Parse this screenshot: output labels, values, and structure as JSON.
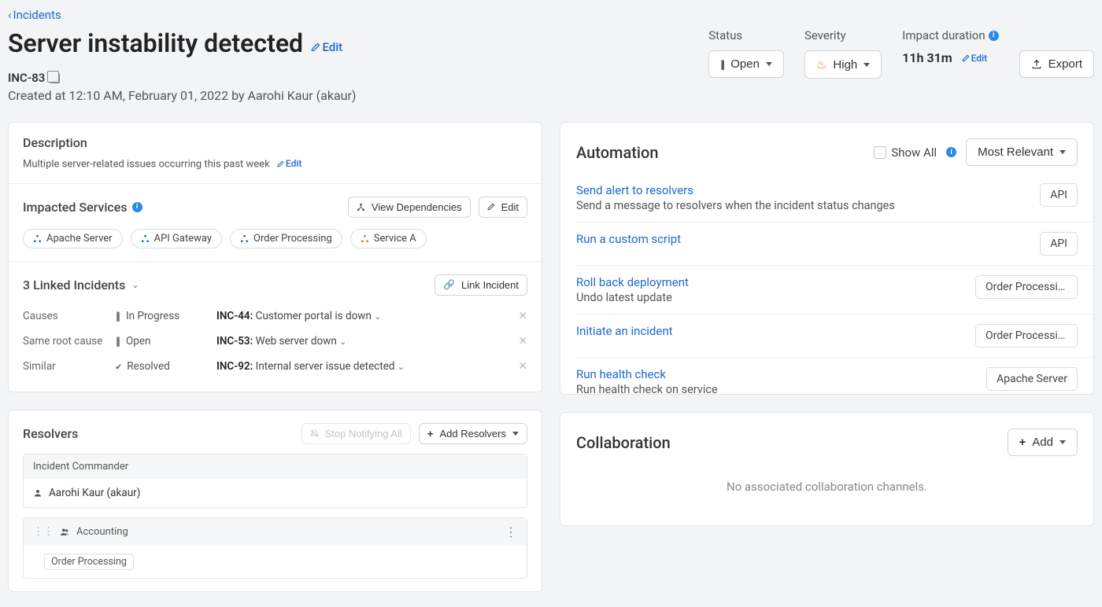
{
  "breadcrumb": {
    "back_label": "Incidents"
  },
  "header": {
    "title": "Server instability detected",
    "edit_label": "Edit",
    "incident_id": "INC-83",
    "created_at": "Created at 12:10 AM, February 01, 2022 by Aarohi Kaur (akaur)"
  },
  "meta": {
    "status_label": "Status",
    "status_value": "Open",
    "severity_label": "Severity",
    "severity_value": "High",
    "impact_label": "Impact duration",
    "impact_value": "11h 31m",
    "impact_edit": "Edit",
    "export_label": "Export"
  },
  "description": {
    "title": "Description",
    "text": "Multiple server-related issues occurring this past week",
    "edit_label": "Edit"
  },
  "impacted": {
    "title": "Impacted Services",
    "view_deps": "View Dependencies",
    "edit_label": "Edit",
    "services": [
      {
        "name": "Apache Server",
        "color": "blue"
      },
      {
        "name": "API Gateway",
        "color": "blue"
      },
      {
        "name": "Order Processing",
        "color": "blue"
      },
      {
        "name": "Service A",
        "color": "orange"
      }
    ]
  },
  "linked": {
    "title": "3 Linked Incidents",
    "link_btn": "Link Incident",
    "rows": [
      {
        "relation": "Causes",
        "status": "In Progress",
        "status_icon": "pause",
        "id": "INC-44:",
        "title": "Customer portal is down"
      },
      {
        "relation": "Same root cause",
        "status": "Open",
        "status_icon": "pause",
        "id": "INC-53:",
        "title": "Web server down"
      },
      {
        "relation": "Similar",
        "status": "Resolved",
        "status_icon": "check",
        "id": "INC-92:",
        "title": "Internal server issue detected"
      }
    ]
  },
  "resolvers": {
    "title": "Resolvers",
    "stop_btn": "Stop Notifying All",
    "add_btn": "Add Resolvers",
    "commander_label": "Incident Commander",
    "commander_name": "Aarohi Kaur (akaur)",
    "team_name": "Accounting",
    "team_tag": "Order Processing"
  },
  "automation": {
    "title": "Automation",
    "show_all": "Show All",
    "sort": "Most Relevant",
    "items": [
      {
        "title": "Send alert to resolvers",
        "sub": "Send a message to resolvers when the incident status changes",
        "tag": "API"
      },
      {
        "title": "Run a custom script",
        "sub": "",
        "tag": "API"
      },
      {
        "title": "Roll back deployment",
        "sub": "Undo latest update",
        "tag": "Order Processing"
      },
      {
        "title": "Initiate an incident",
        "sub": "",
        "tag": "Order Processing"
      },
      {
        "title": "Run health check",
        "sub": "Run health check on service",
        "tag": "Apache Server"
      }
    ]
  },
  "collaboration": {
    "title": "Collaboration",
    "add_btn": "Add",
    "empty": "No associated collaboration channels."
  }
}
